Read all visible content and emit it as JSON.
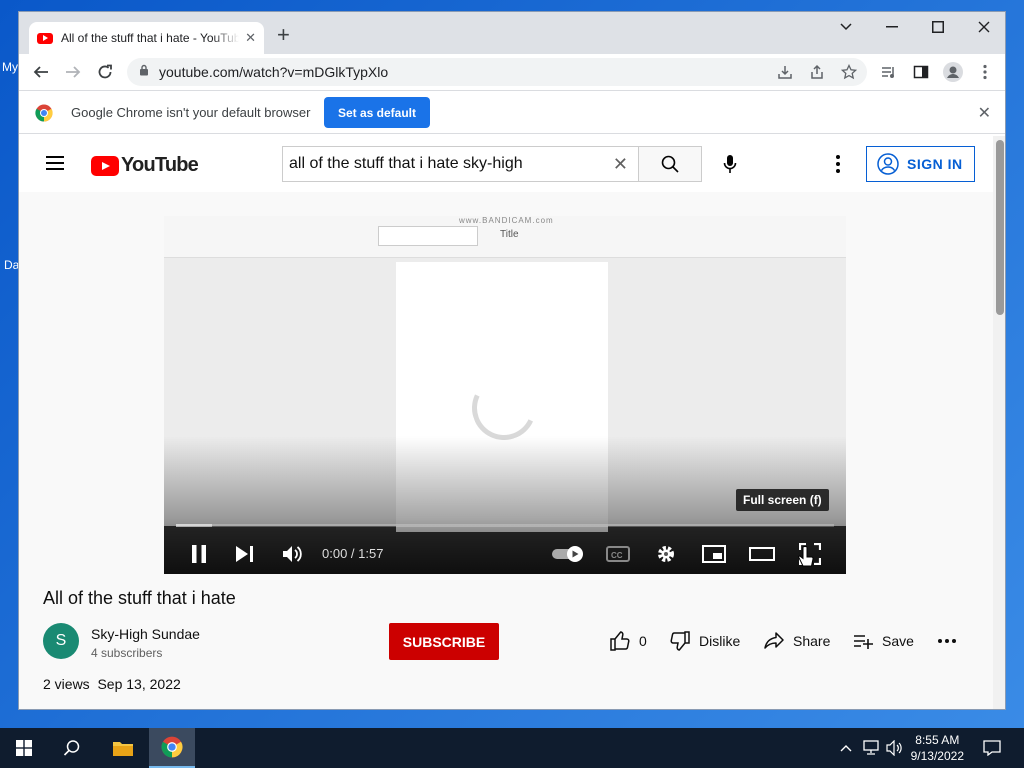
{
  "desktop": {
    "label_top": "My",
    "label_bottom": "Da"
  },
  "browser": {
    "tab_title": "All of the stuff that i hate - YouTube",
    "url": "youtube.com/watch?v=mDGlkTypXlo",
    "infobar_message": "Google Chrome isn't your default browser",
    "set_default_label": "Set as default"
  },
  "youtube": {
    "logo_text": "YouTube",
    "search_query": "all of the stuff that i hate sky-high",
    "sign_in_label": "SIGN IN",
    "player": {
      "ribbon_style_label": "Title",
      "watermark": "www.BANDICAM.com",
      "tooltip": "Full screen (f)",
      "time": "0:00 / 1:57",
      "buffered_fraction": 0.055
    },
    "video_title": "All of the stuff that i hate",
    "channel": {
      "initial": "S",
      "name": "Sky-High Sundae",
      "subscribers": "4 subscribers"
    },
    "subscribe_label": "SUBSCRIBE",
    "actions": {
      "likes": "0",
      "dislike": "Dislike",
      "share": "Share",
      "save": "Save"
    },
    "meta": {
      "views": "2 views",
      "date": "Sep 13, 2022"
    }
  },
  "taskbar": {
    "time": "8:55 AM",
    "date": "9/13/2022"
  }
}
